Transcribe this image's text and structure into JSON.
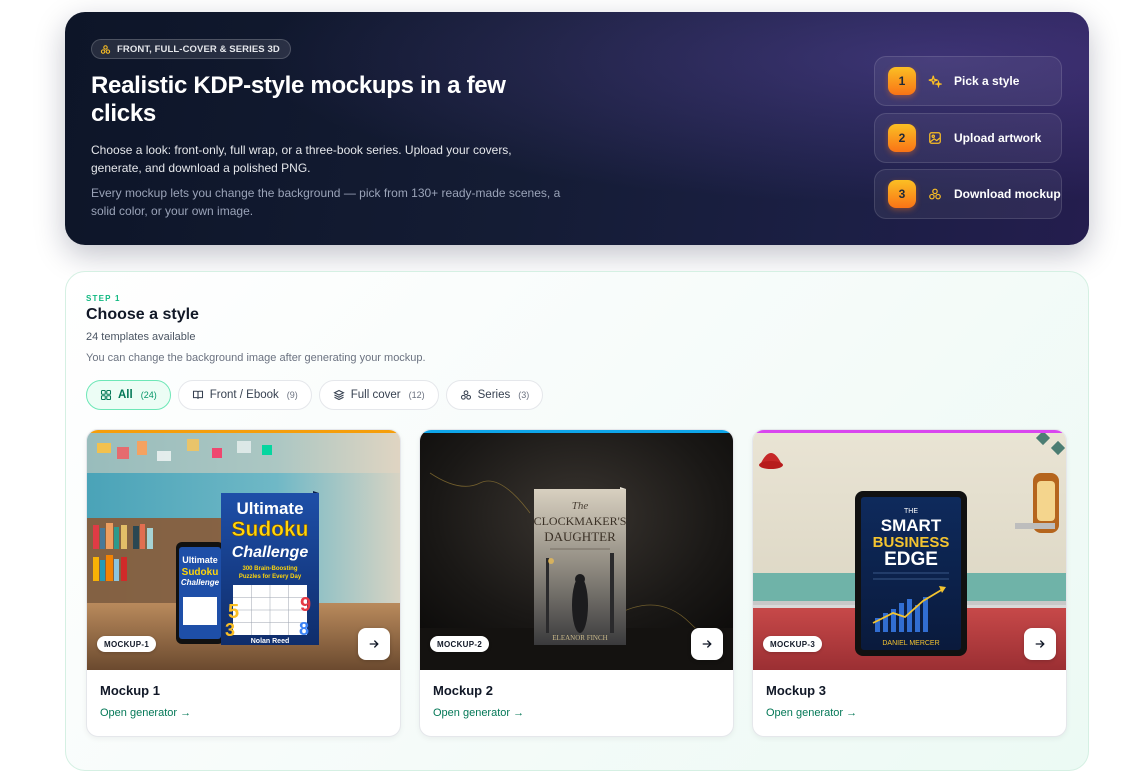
{
  "hero": {
    "pill": "FRONT, FULL-COVER & SERIES 3D",
    "pill_icon": "books-stack-icon",
    "title": "Realistic KDP-style mockups in a few clicks",
    "description": "Choose a look: front-only, full wrap, or a three-book series. Upload your covers, generate, and download a polished PNG.",
    "note": "Every mockup lets you change the background — pick from 130+ ready-made scenes, a solid color, or your own image.",
    "steps": [
      {
        "num": "1",
        "label": "Pick a style",
        "icon": "sparkle-icon"
      },
      {
        "num": "2",
        "label": "Upload artwork",
        "icon": "image-upload-icon"
      },
      {
        "num": "3",
        "label": "Download mockup",
        "icon": "books-stack-icon"
      }
    ]
  },
  "step": {
    "label": "STEP 1",
    "title": "Choose a style",
    "count": "24 templates available",
    "note": "You can change the background image after generating your mockup."
  },
  "filters": [
    {
      "label": "All",
      "count": "(24)",
      "icon": "grid-icon",
      "active": true
    },
    {
      "label": "Front / Ebook",
      "count": "(9)",
      "icon": "book-open-icon",
      "active": false
    },
    {
      "label": "Full cover",
      "count": "(12)",
      "icon": "layers-icon",
      "active": false
    },
    {
      "label": "Series",
      "count": "(3)",
      "icon": "books-stack-icon",
      "active": false
    }
  ],
  "cards": [
    {
      "badge": "MOCKUP-1",
      "name": "Mockup 1",
      "link": "Open generator →",
      "accent": "#f59e0b",
      "book_title_lines": [
        "Ultimate",
        "Sudoku",
        "Challenge"
      ],
      "book_subtitle": "300 Brain-Boosting Puzzles for Every Day",
      "book_author": "Nolan Reed"
    },
    {
      "badge": "MOCKUP-2",
      "name": "Mockup 2",
      "link": "Open generator →",
      "accent": "#0ea5e9",
      "book_title_lines": [
        "The",
        "CLOCKMAKER'S",
        "DAUGHTER"
      ],
      "book_author": "ELEANOR FINCH"
    },
    {
      "badge": "MOCKUP-3",
      "name": "Mockup 3",
      "link": "Open generator →",
      "accent": "#d946ef",
      "book_title_lines": [
        "THE",
        "SMART",
        "BUSINESS",
        "EDGE"
      ],
      "book_author": "DANIEL MERCER"
    }
  ]
}
